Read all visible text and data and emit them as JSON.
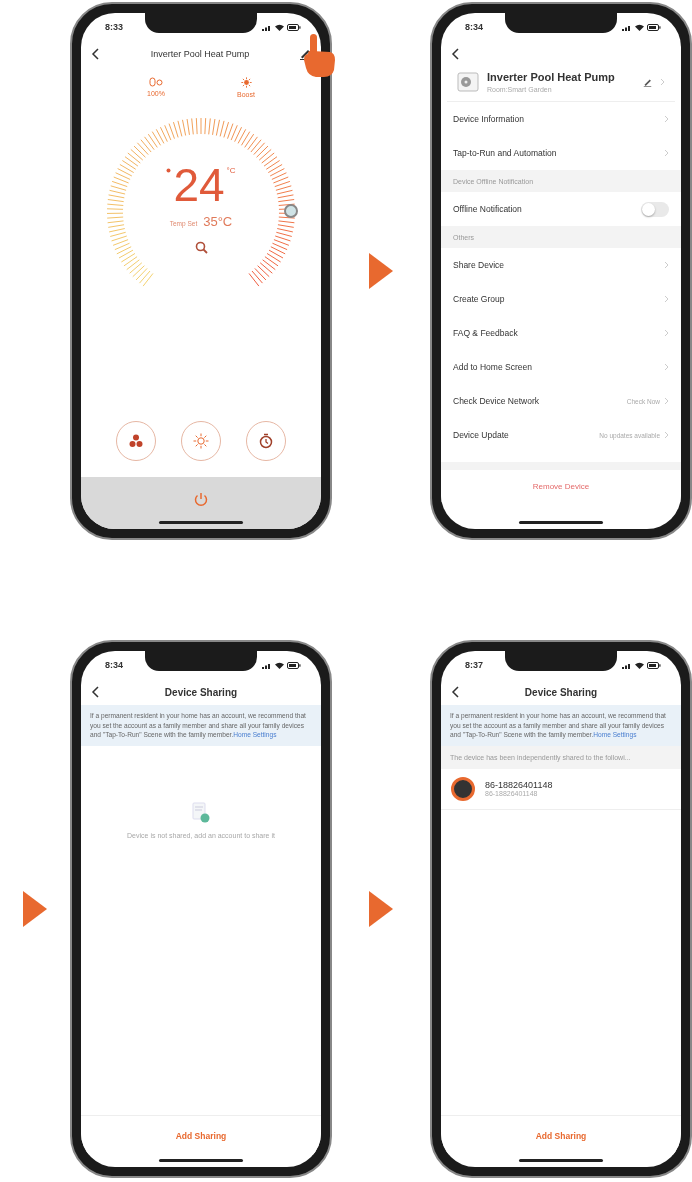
{
  "screens": [
    {
      "kind": "thermostat",
      "time": "8:33",
      "title": "Inverter Pool Heat Pump",
      "indicators": [
        {
          "kind": "capacity",
          "label": "100%"
        },
        {
          "kind": "boost",
          "label": "Boost"
        }
      ],
      "temperature": "24",
      "unit": "°C",
      "set_label": "Temp Set",
      "set_value": "35°C"
    },
    {
      "kind": "settings",
      "time": "8:34",
      "device_name": "Inverter Pool Heat Pump",
      "room": "Room:Smart Garden",
      "rows": [
        {
          "kind": "link",
          "label": "Device Information"
        },
        {
          "kind": "link",
          "label": "Tap-to-Run and Automation"
        },
        {
          "kind": "section",
          "label": "Device Offline Notification"
        },
        {
          "kind": "toggle",
          "label": "Offline Notification",
          "on": false
        },
        {
          "kind": "section",
          "label": "Others"
        },
        {
          "kind": "link",
          "label": "Share Device"
        },
        {
          "kind": "link",
          "label": "Create Group"
        },
        {
          "kind": "link",
          "label": "FAQ & Feedback"
        },
        {
          "kind": "link",
          "label": "Add to Home Screen"
        },
        {
          "kind": "link",
          "label": "Check Device Network",
          "value": "Check Now"
        },
        {
          "kind": "link",
          "label": "Device Update",
          "value": "No updates available"
        }
      ],
      "remove_button": "Remove Device"
    },
    {
      "kind": "sharing",
      "time": "8:34",
      "title": "Device Sharing",
      "notice": "If a permanent resident in your home has an account, we recommend that you set the account as a family member and share all your family devices and \"Tap-To-Run\" Scene with the family member.",
      "notice_link": "Home Settings",
      "empty_text": "Device is not shared, add an account to share it",
      "button": "Add Sharing"
    },
    {
      "kind": "sharing",
      "time": "8:37",
      "title": "Device Sharing",
      "notice": "If a permanent resident in your home has an account, we recommend that you set the account as a family member and share all your family devices and \"Tap-To-Run\" Scene with the family member.",
      "notice_link": "Home Settings",
      "shared_label": "The device has been independently shared to the followi...",
      "members": [
        {
          "name": "86-18826401148",
          "account": "86-18826401148"
        }
      ],
      "button": "Add Sharing"
    }
  ]
}
